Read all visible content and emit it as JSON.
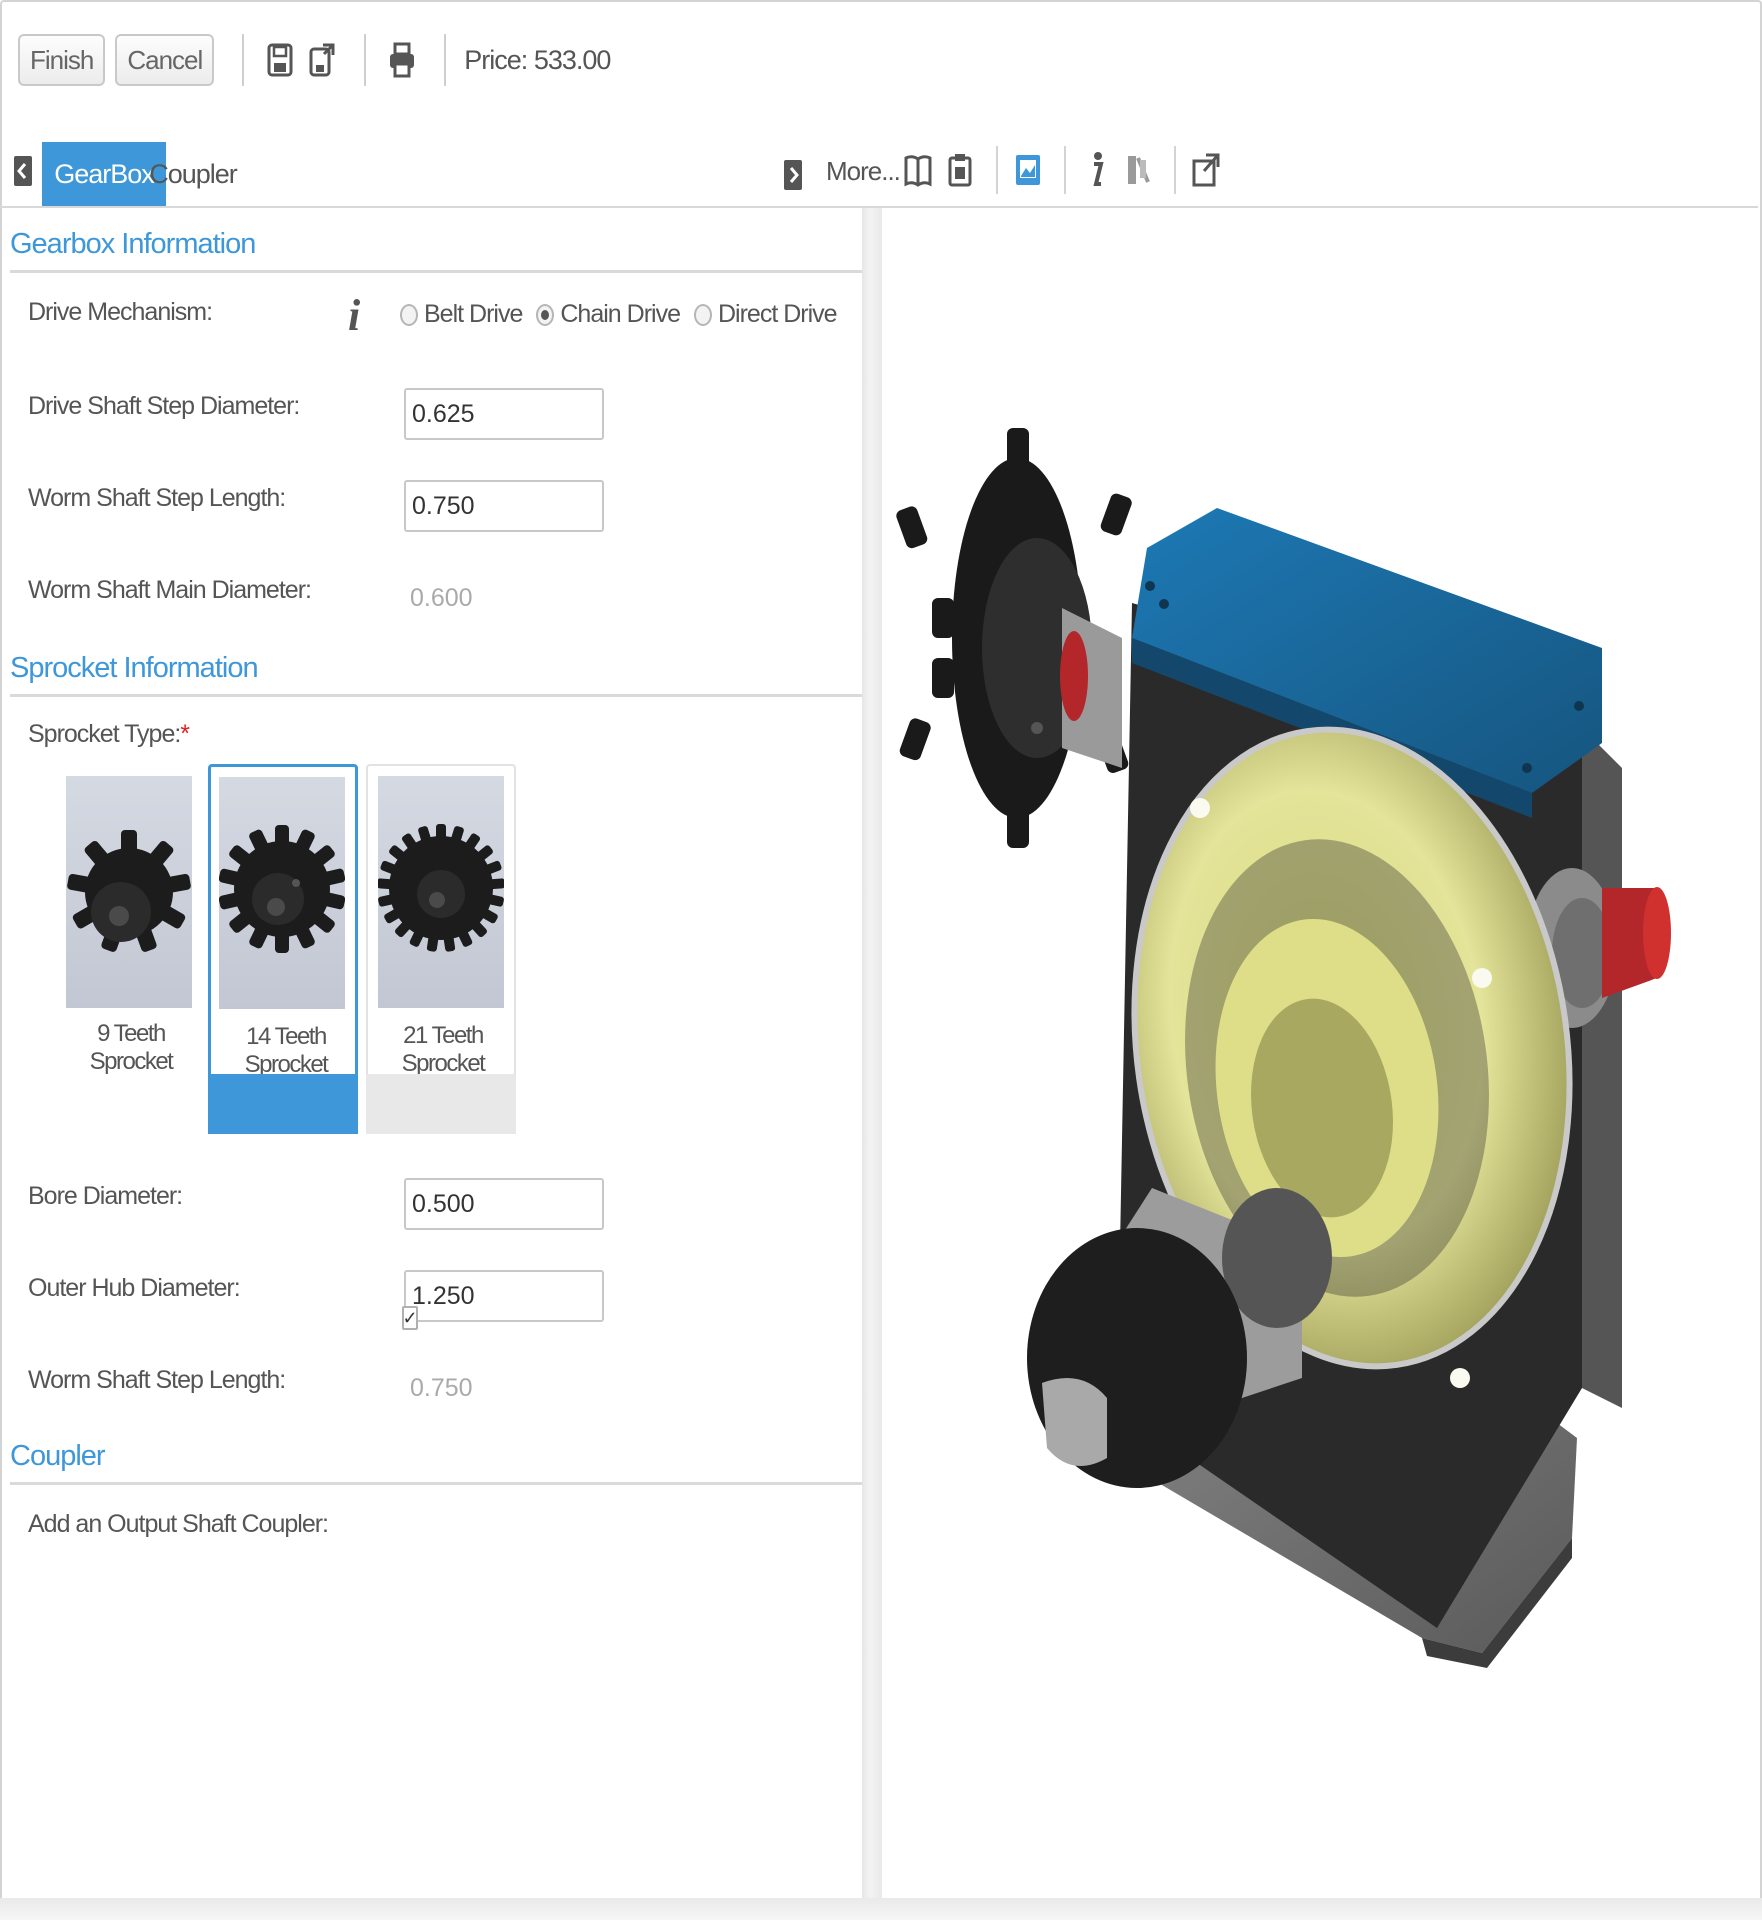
{
  "toolbar": {
    "finish_label": "Finish",
    "cancel_label": "Cancel",
    "icons": [
      "save-icon",
      "save-as-icon",
      "print-icon"
    ],
    "price_text": "Price: 533.00"
  },
  "tabs": [
    {
      "label": "GearBox",
      "active": true
    },
    {
      "label": "Coupler",
      "active": false
    }
  ],
  "viewer_toolbar": {
    "more_label": "More...",
    "icons": [
      "book-icon",
      "clipboard-icon",
      "image-icon",
      "info-icon",
      "attributes-icon",
      "external-link-icon"
    ]
  },
  "sections": {
    "gearbox": {
      "title": "Gearbox Information",
      "drive_mechanism": {
        "label": "Drive Mechanism:",
        "options": [
          "Belt Drive",
          "Chain Drive",
          "Direct Drive"
        ],
        "selected": "Chain Drive"
      },
      "drive_shaft_step_diameter": {
        "label": "Drive Shaft Step Diameter:",
        "value": "0.625"
      },
      "worm_shaft_step_length": {
        "label": "Worm Shaft Step Length:",
        "value": "0.750"
      },
      "worm_shaft_main_diameter": {
        "label": "Worm Shaft Main Diameter:",
        "value": "0.600"
      }
    },
    "sprocket": {
      "title": "Sprocket Information",
      "type_label": "Sprocket Type:",
      "required_marker": "*",
      "options": [
        {
          "label": "9 Teeth Sprocket",
          "teeth": 9,
          "state": "normal"
        },
        {
          "label": "14 Teeth Sprocket",
          "teeth": 14,
          "state": "selected"
        },
        {
          "label": "21 Teeth Sprocket",
          "teeth": 21,
          "state": "hover"
        }
      ],
      "bore_diameter": {
        "label": "Bore Diameter:",
        "value": "0.500"
      },
      "outer_hub_diameter": {
        "label": "Outer Hub Diameter:",
        "value": "1.250"
      },
      "worm_shaft_step_length": {
        "label": "Worm Shaft Step Length:",
        "value": "0.750"
      }
    },
    "coupler": {
      "title": "Coupler",
      "add_coupler": {
        "label": "Add an Output Shaft Coupler:",
        "checked": true,
        "check_glyph": "✓"
      }
    }
  },
  "colors": {
    "accent": "#3d97d9",
    "required": "#e02020",
    "gearbox_lid": "#1f6fa3",
    "gearbox_body": "#2a2a2a",
    "flange": "#e8e89a",
    "shaft_end": "#c8262a"
  }
}
